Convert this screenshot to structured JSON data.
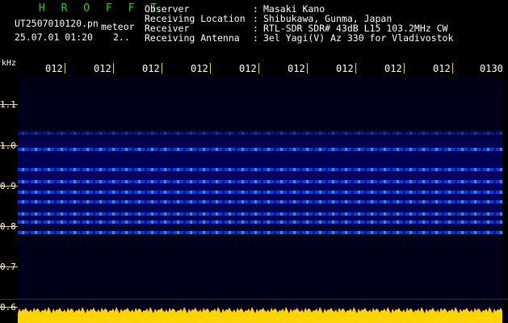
{
  "header": {
    "logo": "H R O F F T",
    "filename": "UT2507010120.pn",
    "signal_type": "meteor",
    "datetime": "25.07.01 01:20",
    "datetime_tail": "2..",
    "fields": [
      {
        "label": "Observer",
        "colon": ":",
        "value": "Masaki Kano"
      },
      {
        "label": "Receiving Location",
        "colon": ":",
        "value": "Shibukawa, Gunma, Japan"
      },
      {
        "label": "Receiver",
        "colon": ":",
        "value": "RTL-SDR SDR# 43dB L15 103.2MHz CW"
      },
      {
        "label": "Receiving Antenna",
        "colon": ":",
        "value": "3el Yagi(V) Az 330 for Vladivostok"
      }
    ]
  },
  "time_axis": {
    "labels": [
      "012",
      "012",
      "012",
      "012",
      "012",
      "012",
      "012",
      "012",
      "012",
      "0130"
    ],
    "marks": [
      "012",
      "012",
      "012",
      "012",
      "012",
      "012",
      "012",
      "012",
      "012",
      "0130"
    ]
  },
  "freq_axis": {
    "unit": "kHz",
    "labels": [
      "1.1",
      "1.0",
      "0.9",
      "0.8",
      "0.7",
      "0.6"
    ]
  },
  "colors": {
    "logo": "#21d421",
    "tick": "#ffd400",
    "background": "#000000",
    "noise_floor": "#000018",
    "trace": "#1a3cff"
  },
  "spectrogram": {
    "trace_levels_khz": [
      1.03,
      0.99,
      0.94,
      0.91,
      0.885,
      0.86,
      0.83,
      0.81,
      0.785
    ]
  }
}
